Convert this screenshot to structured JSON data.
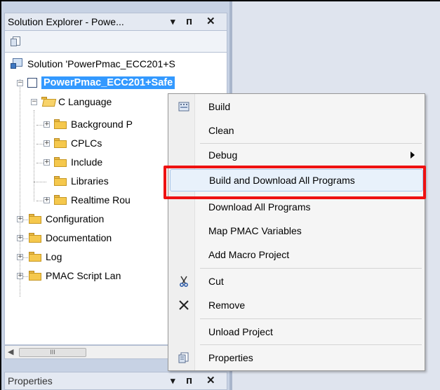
{
  "solution_explorer": {
    "title": "Solution Explorer - Powe...",
    "dropdown_glyph": "▾",
    "pin_glyph": "ᴨ",
    "close_glyph": "✕",
    "tree": {
      "solution_label": "Solution 'PowerPmac_ECC201+S",
      "project_label": "PowerPmac_ECC201+Safe",
      "c_language": "C Language",
      "background": "Background P",
      "cplcs": "CPLCs",
      "include": "Include",
      "libraries": "Libraries",
      "realtime": "Realtime Rou",
      "configuration": "Configuration",
      "documentation": "Documentation",
      "log": "Log",
      "pmac_script": "PMAC Script Lan"
    },
    "scroll_thumb": "III"
  },
  "properties": {
    "title": "Properties"
  },
  "context_menu": {
    "build": "Build",
    "clean": "Clean",
    "debug": "Debug",
    "build_download_all": "Build and Download All Programs",
    "download_all": "Download All Programs",
    "map_vars": "Map PMAC Variables",
    "add_macro": "Add Macro Project",
    "cut": "Cut",
    "remove": "Remove",
    "unload": "Unload Project",
    "properties": "Properties"
  },
  "colors": {
    "selection": "#3399ff",
    "highlight_box": "#ee1111"
  }
}
